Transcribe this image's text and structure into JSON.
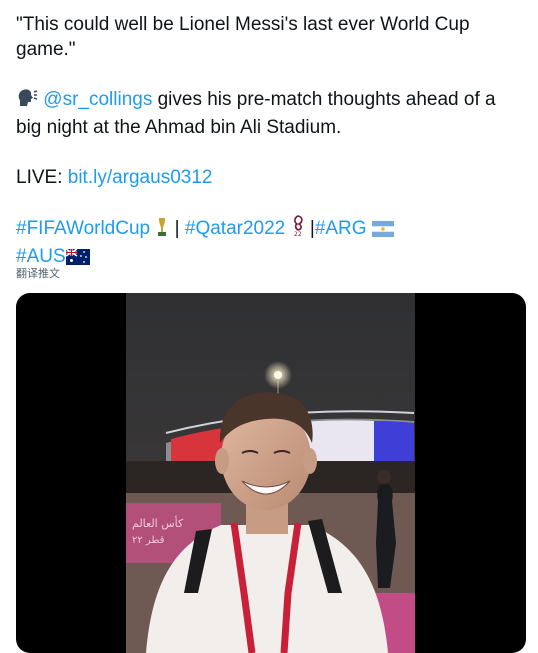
{
  "tweet": {
    "quote": "\"This could well be Lionel Messi's last ever World Cup game.\"",
    "mention": "@sr_collings",
    "line2_rest": " gives his pre-match thoughts ahead of a big night at the Ahmad bin Ali Stadium.",
    "live_label": "LIVE: ",
    "live_link": "bit.ly/argaus0312",
    "hashtags": {
      "fifa": "#FIFAWorldCup",
      "qatar": "#Qatar2022",
      "arg": "#ARG",
      "aus": "#AUS"
    },
    "separator": "|",
    "translate": "翻译推文"
  },
  "video": {
    "banner_text_1": "كأس العالم",
    "banner_text_2": "قطر ٢٢"
  },
  "icons": {
    "speaking": "speaking-head-icon",
    "trophy": "trophy-icon",
    "qatar_logo": "qatar-2022-logo-icon",
    "arg_flag": "argentina-flag-icon",
    "aus_flag": "australia-flag-icon"
  },
  "colors": {
    "link": "#1d9bf0",
    "text": "#0f1419",
    "muted": "#536471"
  }
}
